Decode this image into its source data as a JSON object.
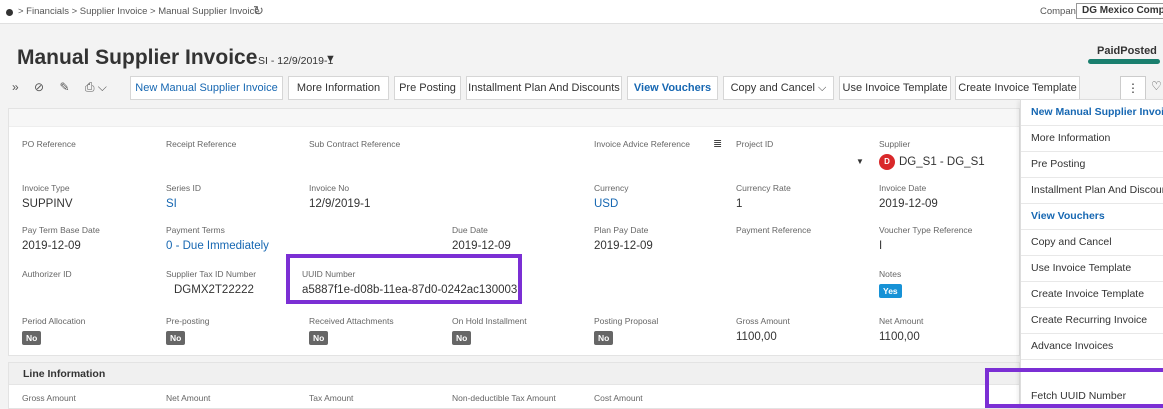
{
  "breadcrumb": {
    "text": "> Financials > Supplier Invoice > Manual Supplier Invoice"
  },
  "company": {
    "label": "Company",
    "value": "DG Mexico Company"
  },
  "header": {
    "title": "Manual Supplier Invoice",
    "subtitle": "SI - 12/9/2019-1",
    "status": "PaidPosted"
  },
  "toolbar": {
    "buttons": [
      "New Manual Supplier Invoice",
      "More Information",
      "Pre Posting",
      "Installment Plan And Discounts",
      "View Vouchers",
      "Copy and Cancel",
      "Use Invoice Template",
      "Create Invoice Template"
    ],
    "more": "⋮"
  },
  "fields": {
    "po_reference": {
      "label": "PO Reference"
    },
    "receipt_reference": {
      "label": "Receipt Reference"
    },
    "sub_contract_reference": {
      "label": "Sub Contract Reference"
    },
    "invoice_advice_reference": {
      "label": "Invoice Advice Reference"
    },
    "project_id": {
      "label": "Project ID"
    },
    "supplier": {
      "label": "Supplier",
      "value": "DG_S1 - DG_S1",
      "avatar": "D"
    },
    "invoice_type": {
      "label": "Invoice Type",
      "value": "SUPPINV"
    },
    "series_id": {
      "label": "Series ID",
      "value": "SI"
    },
    "invoice_no": {
      "label": "Invoice No",
      "value": "12/9/2019-1"
    },
    "currency": {
      "label": "Currency",
      "value": "USD"
    },
    "currency_rate": {
      "label": "Currency Rate",
      "value": "1"
    },
    "invoice_date": {
      "label": "Invoice Date",
      "value": "2019-12-09"
    },
    "pay_term_base_date": {
      "label": "Pay Term Base Date",
      "value": "2019-12-09"
    },
    "payment_terms": {
      "label": "Payment Terms",
      "value": "0 - Due Immediately"
    },
    "due_date": {
      "label": "Due Date",
      "value": "2019-12-09"
    },
    "plan_pay_date": {
      "label": "Plan Pay Date",
      "value": "2019-12-09"
    },
    "payment_reference": {
      "label": "Payment Reference"
    },
    "voucher_type_reference": {
      "label": "Voucher Type Reference",
      "value": "I"
    },
    "authorizer_id": {
      "label": "Authorizer ID"
    },
    "supplier_tax_id": {
      "label": "Supplier Tax ID Number",
      "value": "DGMX2T22222"
    },
    "uuid_number": {
      "label": "UUID Number",
      "value": "a5887f1e-d08b-11ea-87d0-0242ac130003"
    },
    "notes": {
      "label": "Notes",
      "value": "Yes"
    },
    "period_allocation": {
      "label": "Period Allocation",
      "value": "No"
    },
    "pre_posting": {
      "label": "Pre-posting",
      "value": "No"
    },
    "received_attachments": {
      "label": "Received Attachments",
      "value": "No"
    },
    "on_hold_installment": {
      "label": "On Hold Installment",
      "value": "No"
    },
    "posting_proposal": {
      "label": "Posting Proposal",
      "value": "No"
    },
    "gross_amount": {
      "label": "Gross Amount",
      "value": "1100,00"
    },
    "net_amount": {
      "label": "Net Amount",
      "value": "1100,00"
    }
  },
  "line_info": {
    "title": "Line Information",
    "columns": [
      "Gross Amount",
      "Net Amount",
      "Tax Amount",
      "Non-deductible Tax Amount",
      "Cost Amount"
    ]
  },
  "menu": {
    "items": [
      "New Manual Supplier Invoice",
      "More Information",
      "Pre Posting",
      "Installment Plan And Discounts",
      "View Vouchers",
      "Copy and Cancel",
      "Use Invoice Template",
      "Create Invoice Template",
      "Create Recurring Invoice",
      "Advance Invoices",
      "Fetch UUID Number"
    ]
  },
  "colors": {
    "accent": "#1667b2",
    "highlight": "#7b2fd4",
    "status_bar": "#1a7f6e",
    "avatar": "#d9282a"
  }
}
